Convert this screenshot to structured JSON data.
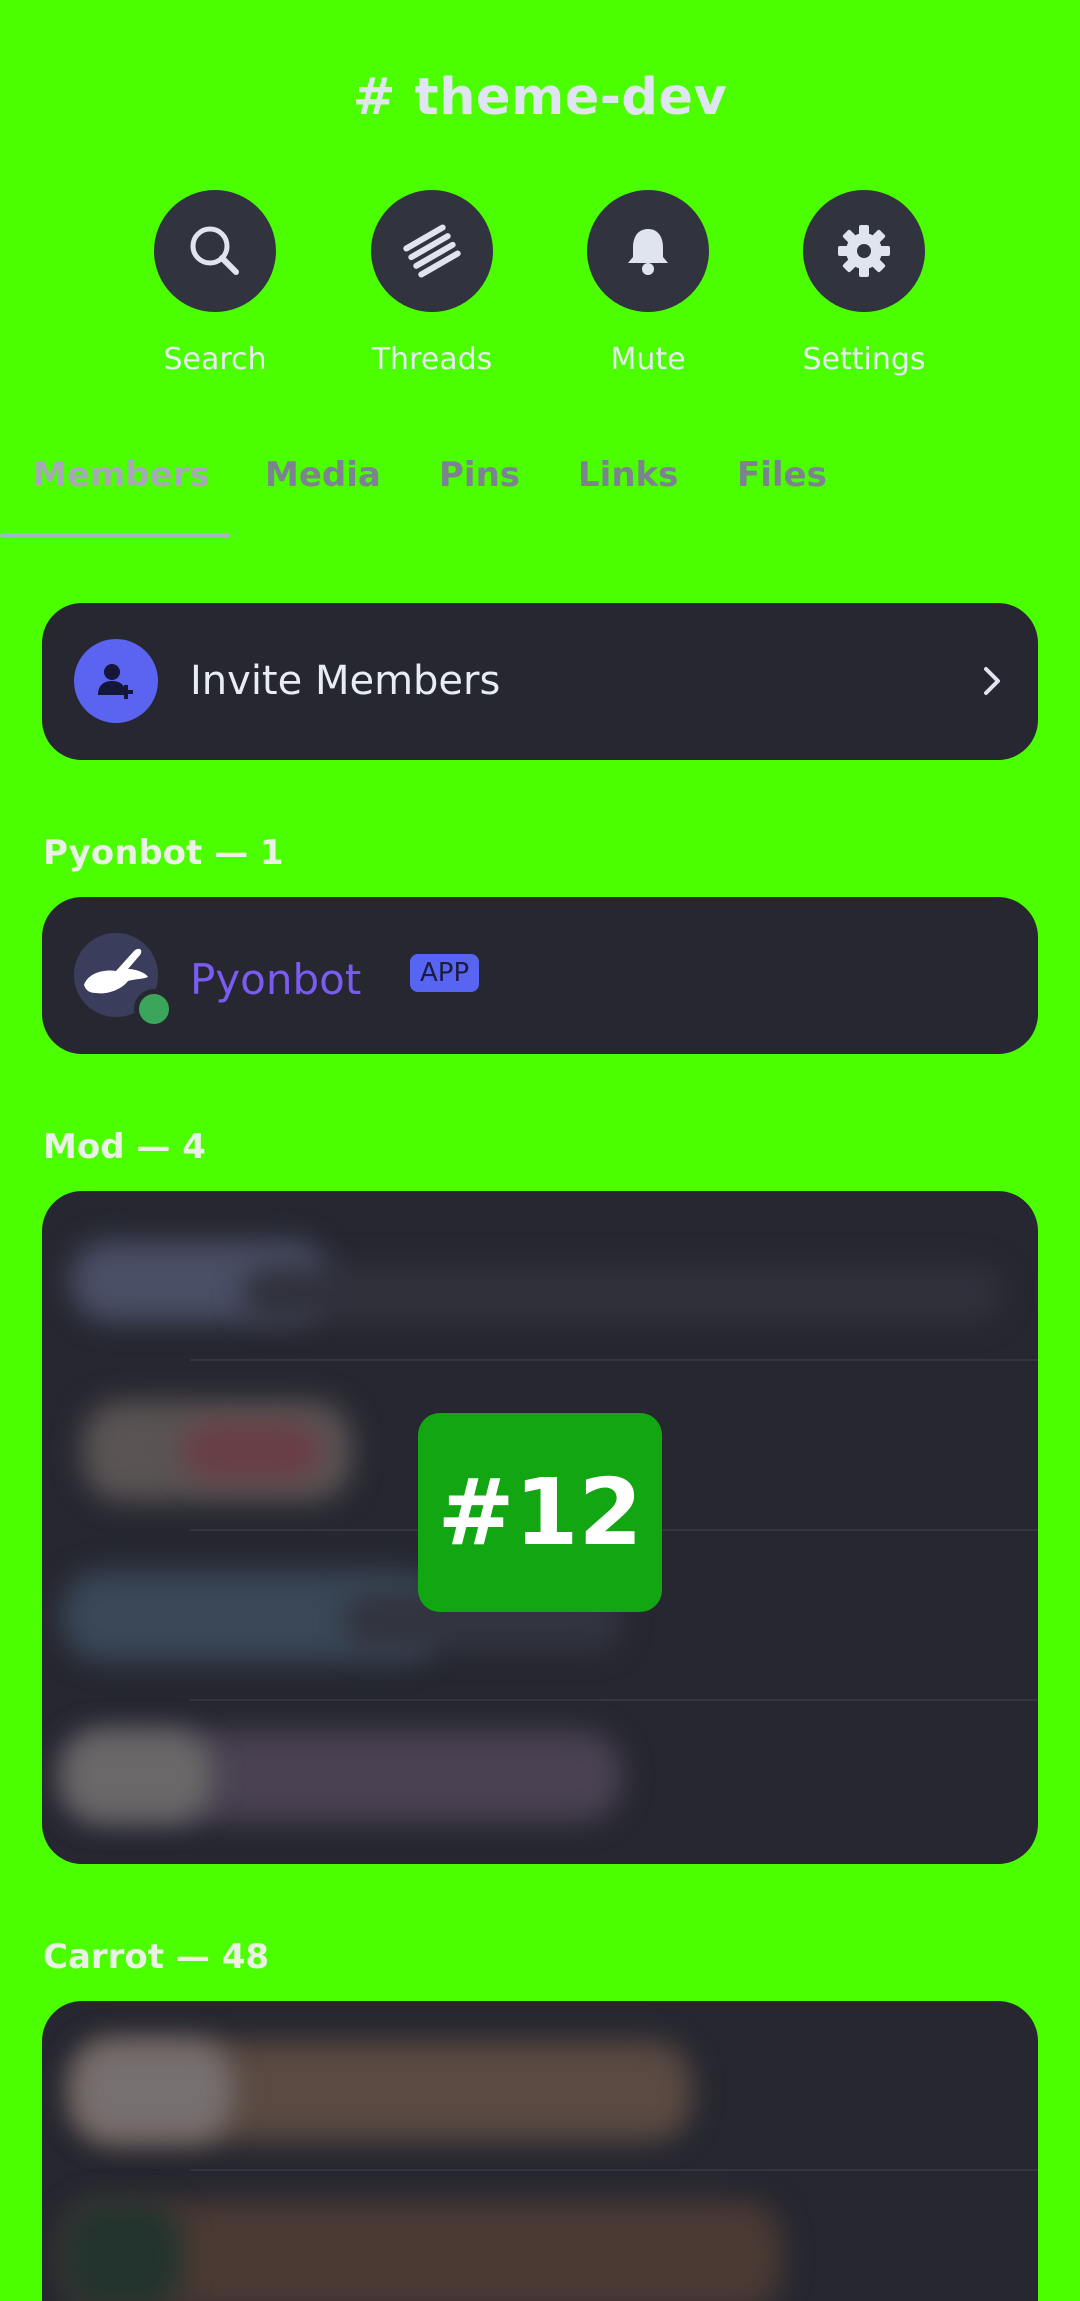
{
  "header": {
    "channel_title": "# theme-dev"
  },
  "actions": [
    {
      "label": "Search",
      "icon": "search-icon"
    },
    {
      "label": "Threads",
      "icon": "threads-icon"
    },
    {
      "label": "Mute",
      "icon": "bell-icon"
    },
    {
      "label": "Settings",
      "icon": "gear-icon"
    }
  ],
  "tabs": [
    {
      "label": "Members",
      "active": true
    },
    {
      "label": "Media"
    },
    {
      "label": "Pins"
    },
    {
      "label": "Links"
    },
    {
      "label": "Files"
    }
  ],
  "invite": {
    "label": "Invite Members"
  },
  "sections": [
    {
      "label": "Pyonbot — 1"
    },
    {
      "label": "Mod — 4"
    },
    {
      "label": "Carrot — 48"
    }
  ],
  "bot": {
    "name": "Pyonbot",
    "badge": "APP"
  },
  "overlay_badge": "#12",
  "colors": {
    "background": "#4cff00",
    "card": "#262730",
    "accent": "#5865f2"
  }
}
